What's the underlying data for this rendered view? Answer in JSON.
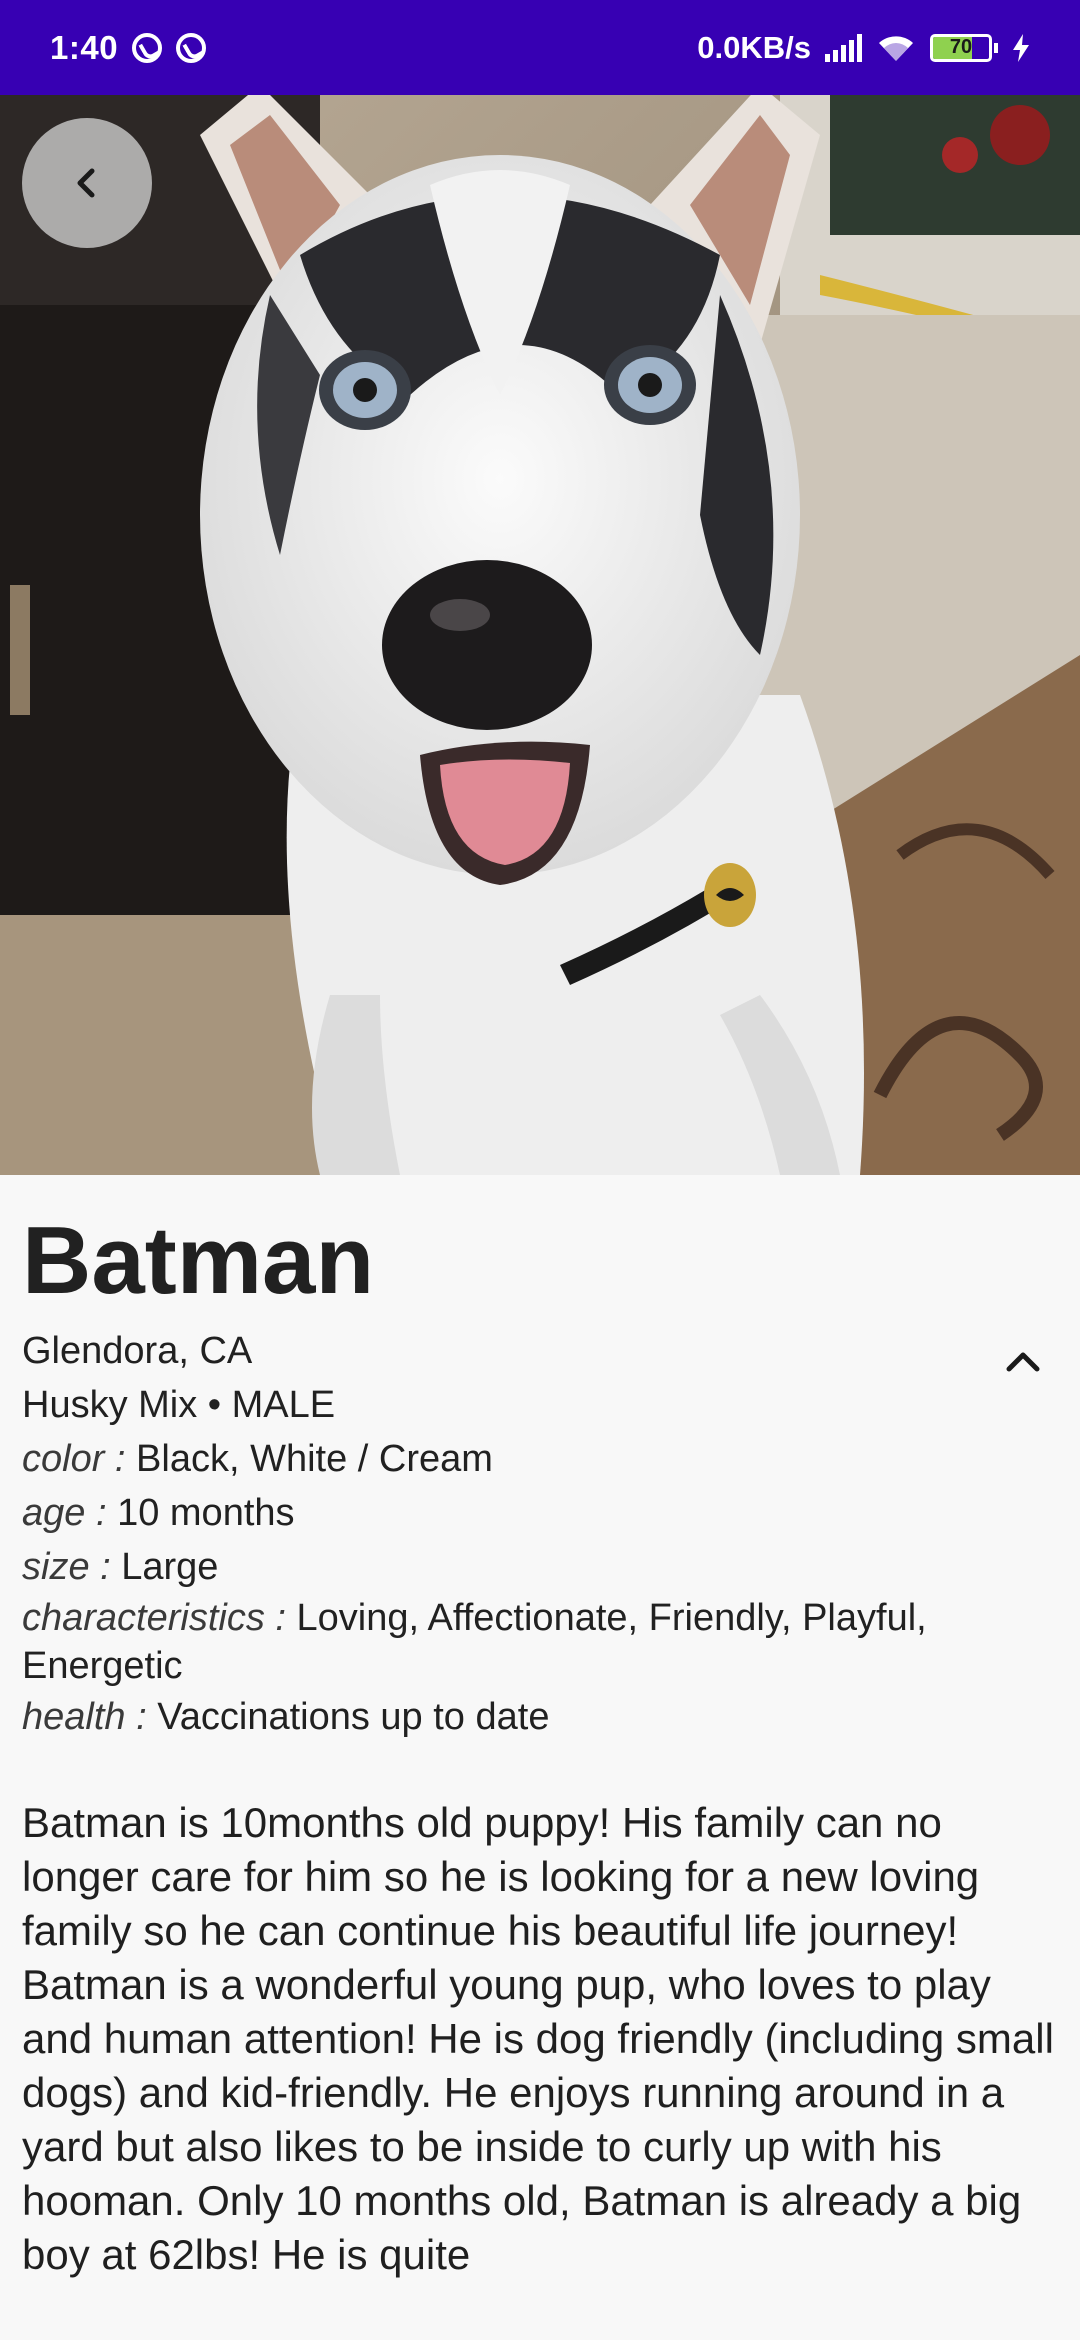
{
  "status_bar": {
    "time": "1:40",
    "network_speed": "0.0KB/s",
    "battery_level": "70",
    "battery_fraction": 0.7,
    "icons": [
      "sync-icon",
      "sync-icon",
      "signal-icon",
      "wifi-icon",
      "battery-icon",
      "charging-icon"
    ]
  },
  "toolbar": {
    "back_icon": "chevron-left-icon"
  },
  "pet": {
    "name": "Batman",
    "location": "Glendora, CA",
    "breed_gender": "Husky Mix • MALE",
    "details": [
      {
        "label": "color : ",
        "value": "Black, White / Cream"
      },
      {
        "label": "age : ",
        "value": "10 months"
      },
      {
        "label": "size : ",
        "value": "Large"
      },
      {
        "label": "characteristics : ",
        "value": "Loving, Affectionate, Friendly, Playful, Energetic"
      },
      {
        "label": "health : ",
        "value": "Vaccinations up to date"
      }
    ],
    "description": [
      "Batman is 10months old puppy! His family can no longer care for him so he is looking for a new loving family so he can continue his beautiful life journey!",
      "Batman is a wonderful young pup, who loves to play and human attention! He is dog friendly (including small dogs) and kid-friendly. He enjoys running around in a yard but also likes to be inside to curly up with his hooman. Only 10 months old, Batman is already a big boy at 62lbs! He is quite"
    ],
    "collapse_icon": "chevron-up-icon"
  },
  "colors": {
    "status_bar": "#3700b3",
    "background": "#f8f8f8",
    "text": "#212121"
  }
}
